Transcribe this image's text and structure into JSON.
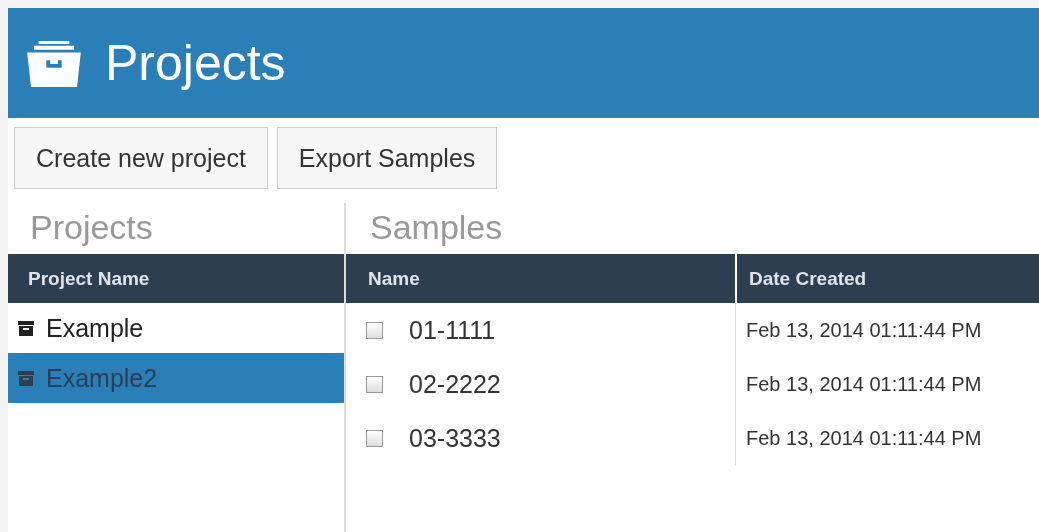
{
  "header": {
    "title": "Projects"
  },
  "buttons": [
    "Create new project",
    "Export Samples"
  ],
  "projects": {
    "title": "Projects",
    "columns": [
      "Project Name"
    ],
    "rows": [
      {
        "name": "Example",
        "selected": false
      },
      {
        "name": "Example2",
        "selected": true
      }
    ]
  },
  "samples": {
    "title": "Samples",
    "columns": [
      "Name",
      "Date Created"
    ],
    "rows": [
      {
        "name": "01-1111",
        "date": "Feb 13, 2014 01:11:44 PM",
        "checked": false
      },
      {
        "name": "02-2222",
        "date": "Feb 13, 2014 01:11:44 PM",
        "checked": false
      },
      {
        "name": "03-3333",
        "date": "Feb 13, 2014 01:11:44 PM",
        "checked": false
      }
    ]
  }
}
